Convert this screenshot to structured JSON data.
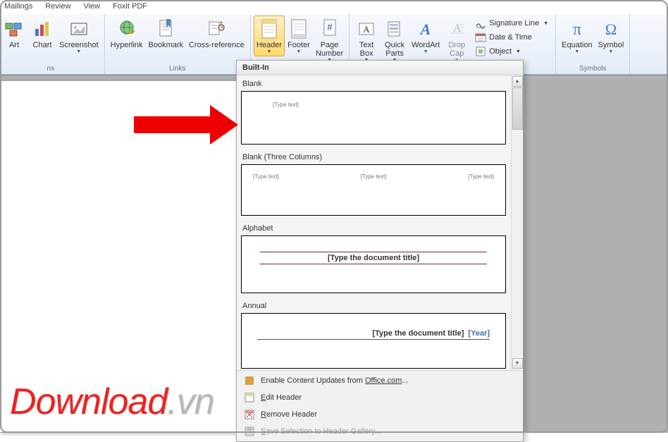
{
  "tabs": {
    "mailings": "Mailings",
    "review": "Review",
    "view": "View",
    "foxit": "Foxit PDF"
  },
  "ribbon": {
    "groups": {
      "illustrations": {
        "art": "Art",
        "chart": "Chart",
        "screenshot": "Screenshot",
        "label": "ns"
      },
      "links": {
        "hyperlink": "Hyperlink",
        "bookmark": "Bookmark",
        "crossref": "Cross-reference",
        "label": "Links"
      },
      "headerfooter": {
        "header": "Header",
        "footer": "Footer",
        "pagenum": "Page\nNumber"
      },
      "text": {
        "textbox": "Text\nBox",
        "quickparts": "Quick\nParts",
        "wordart": "WordArt",
        "dropcap": "Drop\nCap",
        "sigline": "Signature Line",
        "datetime": "Date & Time",
        "object": "Object"
      },
      "symbols": {
        "equation": "Equation",
        "symbol": "Symbol",
        "label": "Symbols"
      }
    }
  },
  "dropdown": {
    "header": "Built-In",
    "blank": {
      "label": "Blank",
      "placeholder": "[Type text]"
    },
    "blank3": {
      "label": "Blank (Three Columns)",
      "p1": "[Type text]",
      "p2": "[Type text]",
      "p3": "[Type text]"
    },
    "alphabet": {
      "label": "Alphabet",
      "placeholder": "[Type the document title]"
    },
    "annual": {
      "label": "Annual",
      "placeholder": "[Type the document title]",
      "year": "[Year]"
    },
    "footer": {
      "updates_pre": "Enable Content Updates from ",
      "updates_link": "Office.com",
      "updates_post": "...",
      "edit": "Edit Header",
      "edit_u": "E",
      "remove": "Remove Header",
      "remove_u": "R",
      "save": "Save Selection to Header Gallery...",
      "save_u": "S"
    }
  },
  "watermark": {
    "text": "Download",
    "suffix": ".vn"
  }
}
